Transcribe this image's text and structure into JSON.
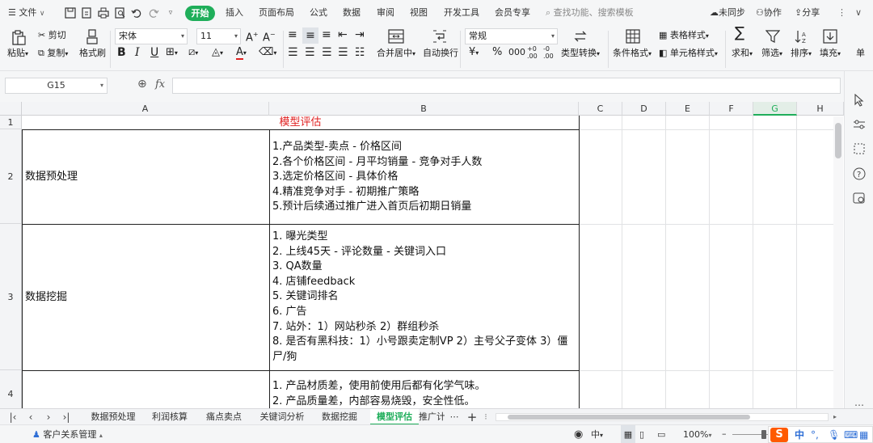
{
  "menu": {
    "file": "文件",
    "tabs": [
      "开始",
      "插入",
      "页面布局",
      "公式",
      "数据",
      "审阅",
      "视图",
      "开发工具",
      "会员专享"
    ],
    "search_placeholder": "查找功能、搜索模板",
    "sync": "未同步",
    "collab": "协作",
    "share": "分享"
  },
  "ribbon": {
    "paste": "粘贴",
    "cut": "剪切",
    "copy": "复制",
    "format_painter": "格式刷",
    "font_name": "宋体",
    "font_size": "11",
    "merge_center": "合并居中",
    "auto_wrap": "自动换行",
    "number_format": "常规",
    "type_convert": "类型转换",
    "conditional_format": "条件格式",
    "table_style": "表格样式",
    "cell_style": "单元格样式",
    "sum": "求和",
    "filter": "筛选",
    "sort": "排序",
    "fill": "填充",
    "single": "单",
    "font_color": "#e02020",
    "accent": "#1fae5a"
  },
  "formula_bar": {
    "name_box": "G15",
    "fx": "fx",
    "formula_value": ""
  },
  "sheet": {
    "columns": [
      "A",
      "B",
      "C",
      "D",
      "E",
      "F",
      "G",
      "H"
    ],
    "selected_column": "G",
    "title": "模型评估",
    "title_color": "#e02020",
    "rows": [
      {
        "num": "2",
        "label": "数据预处理",
        "lines": [
          "1.产品类型-卖点 - 价格区间",
          "2.各个价格区间 - 月平均销量 - 竞争对手人数",
          "3.选定价格区间 - 具体价格",
          "4.精准竞争对手 - 初期推广策略",
          "5.预计后续通过推广进入首页后初期日销量"
        ]
      },
      {
        "num": "3",
        "label": "数据挖掘",
        "lines": [
          "1. 曝光类型",
          "2. 上线45天 - 评论数量 - 关键词入口",
          "3. QA数量",
          "4. 店铺feedback",
          "5. 关键词排名",
          "6. 广告",
          "7. 站外：1）网站秒杀 2）群组秒杀",
          "8. 是否有黑科技：1）小号跟卖定制VP 2）主号父子变体 3）僵",
          "尸/狗"
        ]
      },
      {
        "num": "4",
        "label": "",
        "lines": [
          "1. 产品材质差，使用前使用后都有化学气味。",
          "2. 产品质量差，内部容易烧毁，安全性低。"
        ]
      }
    ]
  },
  "sheet_tabs": [
    "数据预处理",
    "利润核算",
    "痛点卖点",
    "关键词分析",
    "数据挖掘",
    "模型评估",
    "推广计"
  ],
  "active_sheet": "模型评估",
  "status": {
    "crm": "客户关系管理",
    "zoom": "100%",
    "ime_lang": "中"
  }
}
